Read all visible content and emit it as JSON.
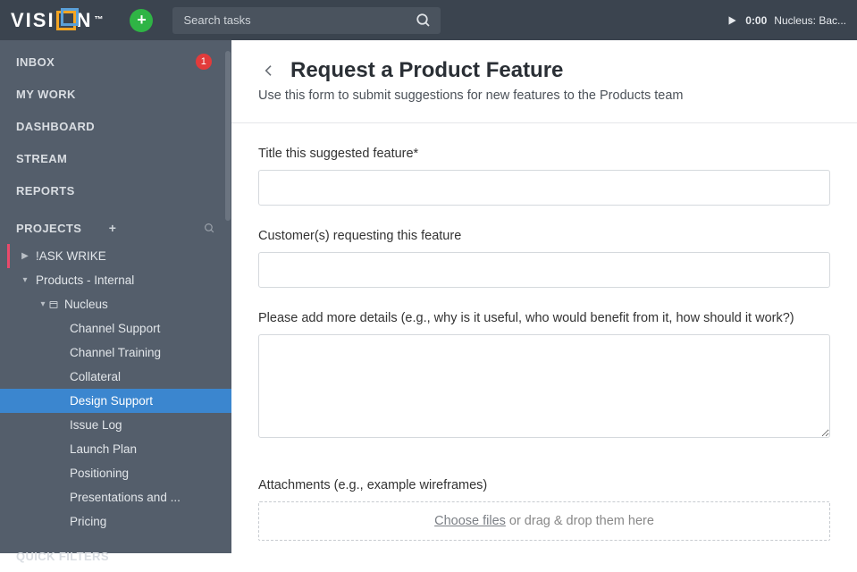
{
  "header": {
    "logo_pre": "VISI",
    "logo_post": "N",
    "logo_tm": "™",
    "add_label": "+",
    "search_placeholder": "Search tasks",
    "timer_time": "0:00",
    "timer_task": "Nucleus: Bac..."
  },
  "sidebar": {
    "nav": [
      {
        "label": "INBOX",
        "badge": "1"
      },
      {
        "label": "MY WORK"
      },
      {
        "label": "DASHBOARD"
      },
      {
        "label": "STREAM"
      },
      {
        "label": "REPORTS"
      }
    ],
    "projects_label": "PROJECTS",
    "tree": {
      "root1": {
        "label": "!ASK WRIKE"
      },
      "root2": {
        "label": "Products - Internal"
      },
      "level1": {
        "label": "Nucleus"
      },
      "items": [
        "Channel Support",
        "Channel Training",
        "Collateral",
        "Design Support",
        "Issue Log",
        "Launch Plan",
        "Positioning",
        "Presentations and ...",
        "Pricing"
      ],
      "selected_index": 3
    },
    "quick_filters": "QUICK FILTERS"
  },
  "form": {
    "title": "Request a Product Feature",
    "subtitle": "Use this form to submit suggestions for new features to the Products team",
    "field_title_label": "Title this suggested feature*",
    "field_customers_label": "Customer(s) requesting this feature",
    "field_details_label": "Please add more details (e.g., why is it useful, who would benefit from it, how should it work?)",
    "field_attachments_label": "Attachments (e.g., example wireframes)",
    "choose_files": "Choose files",
    "drop_hint": " or drag & drop them here"
  }
}
